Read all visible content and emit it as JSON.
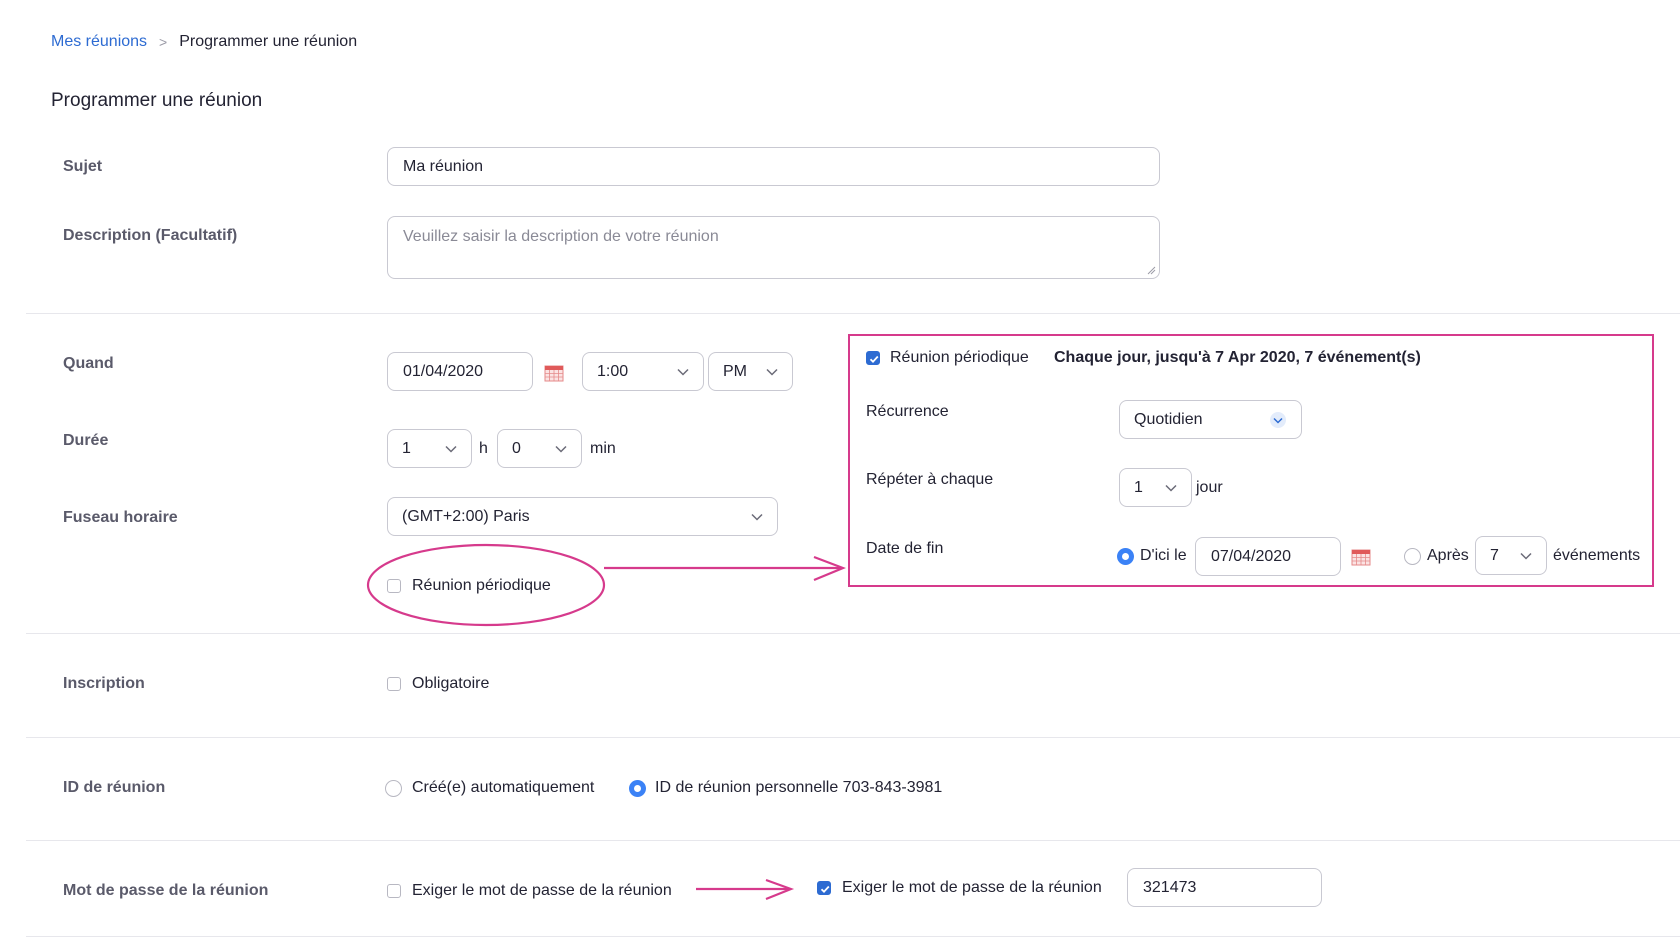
{
  "breadcrumb": {
    "link": "Mes réunions",
    "separator": ">",
    "current": "Programmer une réunion"
  },
  "page_title": "Programmer une réunion",
  "topic": {
    "label": "Sujet",
    "value": "Ma réunion"
  },
  "description": {
    "label": "Description (Facultatif)",
    "placeholder": "Veuillez saisir la description de votre réunion"
  },
  "when": {
    "label": "Quand",
    "date": "01/04/2020",
    "time": "1:00",
    "ampm": "PM"
  },
  "duration": {
    "label": "Durée",
    "hours": "1",
    "hours_unit": "h",
    "minutes": "0",
    "minutes_unit": "min"
  },
  "timezone": {
    "label": "Fuseau horaire",
    "value": "(GMT+2:00) Paris"
  },
  "recurring": {
    "checkbox_label": "Réunion périodique",
    "checked": false
  },
  "recurring_panel": {
    "checkbox_label": "Réunion périodique",
    "checked": true,
    "summary": "Chaque jour, jusqu'à 7 Apr 2020, 7 événement(s)",
    "recurrence_label": "Récurrence",
    "recurrence_value": "Quotidien",
    "repeat_label": "Répéter à chaque",
    "repeat_value": "1",
    "repeat_unit": "jour",
    "end_label": "Date de fin",
    "end_by_label": "D'ici le",
    "end_by_date": "07/04/2020",
    "after_label": "Après",
    "after_value": "7",
    "after_unit": "événements"
  },
  "registration": {
    "label": "Inscription",
    "checkbox_label": "Obligatoire"
  },
  "meeting_id": {
    "label": "ID de réunion",
    "auto_label": "Créé(e) automatiquement",
    "personal_label": "ID de réunion personnelle 703-843-3981"
  },
  "password": {
    "label": "Mot de passe de la réunion",
    "checkbox_label": "Exiger le mot de passe de la réunion",
    "checkbox_label_checked": "Exiger le mot de passe de la réunion",
    "value": "321473"
  },
  "colors": {
    "link": "#2d6bd2",
    "accent": "#3b82f6",
    "annotation": "#d63a8c"
  }
}
